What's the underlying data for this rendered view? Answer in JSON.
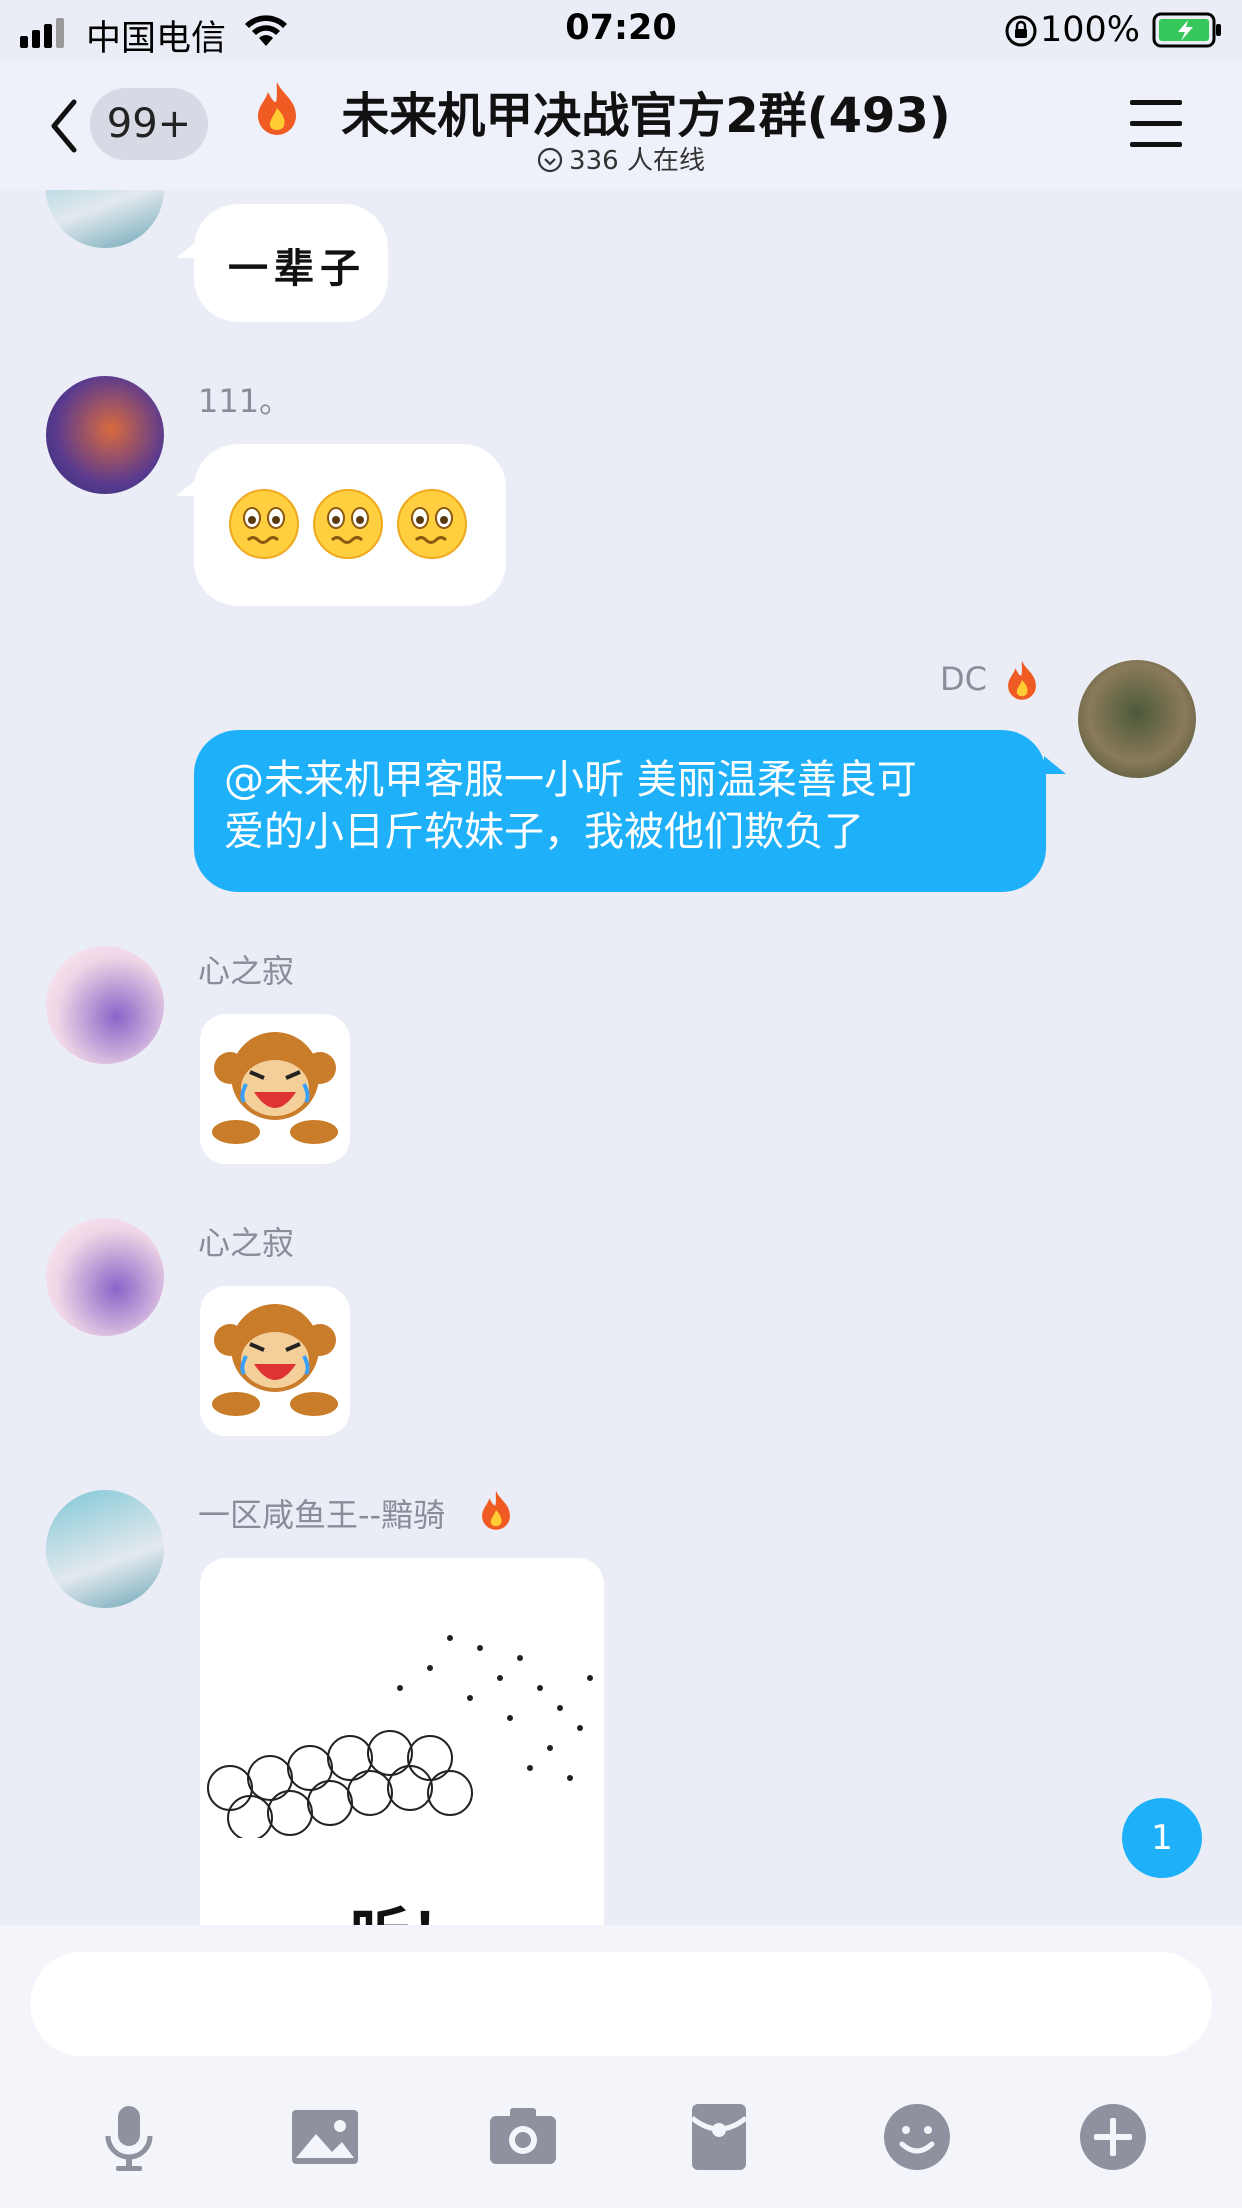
{
  "status_bar": {
    "carrier": "中国电信",
    "time": "07:20",
    "battery": "100%"
  },
  "header": {
    "back_badge": "99+",
    "title": "未来机甲决战官方2群(493)",
    "online": "336 人在线"
  },
  "messages": [
    {
      "sender": "",
      "text": "一辈子",
      "type": "text"
    },
    {
      "sender": "111。",
      "type": "emoji",
      "emoji_count": 3,
      "emoji": "worried-face"
    },
    {
      "sender": "DC",
      "text": "@未来机甲客服一小昕 美丽温柔善良可爱的小日斤软妹子，我被他们欺负了",
      "type": "text",
      "mine": true,
      "line1": "@未来机甲客服一小昕 美丽温柔善良可",
      "line2": "爱的小日斤软妹子，我被他们欺负了"
    },
    {
      "sender": "心之寂",
      "type": "sticker",
      "sticker": "crying-monkey"
    },
    {
      "sender": "心之寂",
      "type": "sticker",
      "sticker": "crying-monkey"
    },
    {
      "sender": "一区咸鱼王--黯骑",
      "type": "image",
      "caption": "听！"
    }
  ],
  "unread_count": "1",
  "colors": {
    "accent": "#1eb1fa",
    "background": "#ebedf6"
  },
  "toolbar_icons": [
    "mic-icon",
    "image-icon",
    "camera-icon",
    "red-packet-icon",
    "emoji-icon",
    "plus-icon"
  ]
}
